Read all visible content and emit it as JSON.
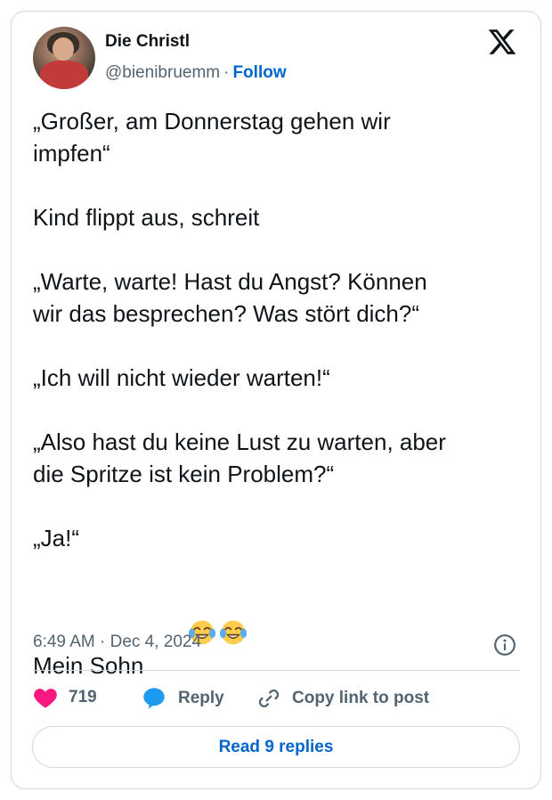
{
  "author": {
    "name": "Die Christl",
    "handle": "@bienibruemm",
    "separator": "·",
    "follow_label": "Follow"
  },
  "tweet": {
    "paragraphs": [
      "„Großer, am Donnerstag gehen wir\nimpfen“",
      "Kind flippt aus, schreit",
      "„Warte, warte! Hast du Angst? Können\nwir das besprechen? Was stört dich?“",
      "„Ich will nicht wieder warten!“",
      "„Also hast du keine Lust zu warten, aber\ndie Spritze ist kein Problem?“",
      "„Ja!“"
    ],
    "last_line": "Mein Sohn",
    "emojis": [
      "tears-of-joy-emoji",
      "tears-of-joy-emoji"
    ],
    "timestamp": "6:49 AM · Dec 4, 2024"
  },
  "actions": {
    "like_count": "719",
    "reply_label": "Reply",
    "copy_label": "Copy link to post"
  },
  "read_replies_label": "Read 9 replies",
  "colors": {
    "accent": "#0066cc",
    "like": "#f91880",
    "reply_icon": "#1d9bf0",
    "muted": "#536471",
    "border": "#cfd9de"
  }
}
